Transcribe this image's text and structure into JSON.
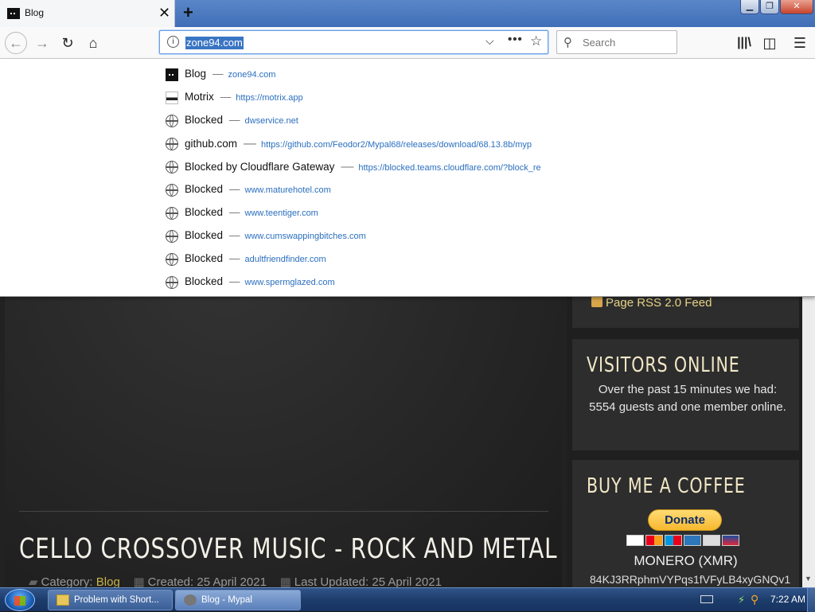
{
  "browser": {
    "tab_title": "Blog",
    "tab_close": "✕",
    "new_tab": "+",
    "url": "zone94.com",
    "search_placeholder": "Search"
  },
  "dropdown": [
    {
      "title": "Blog",
      "url": "zone94.com",
      "icon": "blog-favicon"
    },
    {
      "title": "Motrix",
      "url": "https://motrix.app",
      "icon": "motrix-favicon"
    },
    {
      "title": "Blocked",
      "url": "dwservice.net",
      "icon": "globe-icon"
    },
    {
      "title": "github.com",
      "url": "https://github.com/Feodor2/Mypal68/releases/download/68.13.8b/myp",
      "icon": "globe-icon"
    },
    {
      "title": "Blocked by Cloudflare Gateway",
      "url": "https://blocked.teams.cloudflare.com/?block_re",
      "icon": "globe-icon"
    },
    {
      "title": "Blocked",
      "url": "www.maturehotel.com",
      "icon": "globe-icon"
    },
    {
      "title": "Blocked",
      "url": "www.teentiger.com",
      "icon": "globe-icon"
    },
    {
      "title": "Blocked",
      "url": "www.cumswappingbitches.com",
      "icon": "globe-icon"
    },
    {
      "title": "Blocked",
      "url": "adultfriendfinder.com",
      "icon": "globe-icon"
    },
    {
      "title": "Blocked",
      "url": "www.spermglazed.com",
      "icon": "globe-icon"
    }
  ],
  "page": {
    "article_title": "CELLO CROSSOVER MUSIC - ROCK AND METAL",
    "meta_category_label": "Category:",
    "meta_category": "Blog",
    "meta_created": "Created: 25 April 2021",
    "meta_updated": "Last Updated: 25 April 2021",
    "rss": "Page RSS 2.0 Feed",
    "visitors_title": "VISITORS ONLINE",
    "visitors_text": "Over the past 15 minutes we had: 5554 guests and one member online.",
    "coffee_title": "BUY ME A COFFEE",
    "donate": "Donate",
    "monero_label": "MONERO (XMR)",
    "monero_addr": "84KJ3RRphmVYPqs1fVFyLB4xyGNQv1"
  },
  "taskbar": {
    "tasks": [
      "Problem with Short...",
      "Blog - Mypal"
    ],
    "clock": "7:22 AM"
  }
}
